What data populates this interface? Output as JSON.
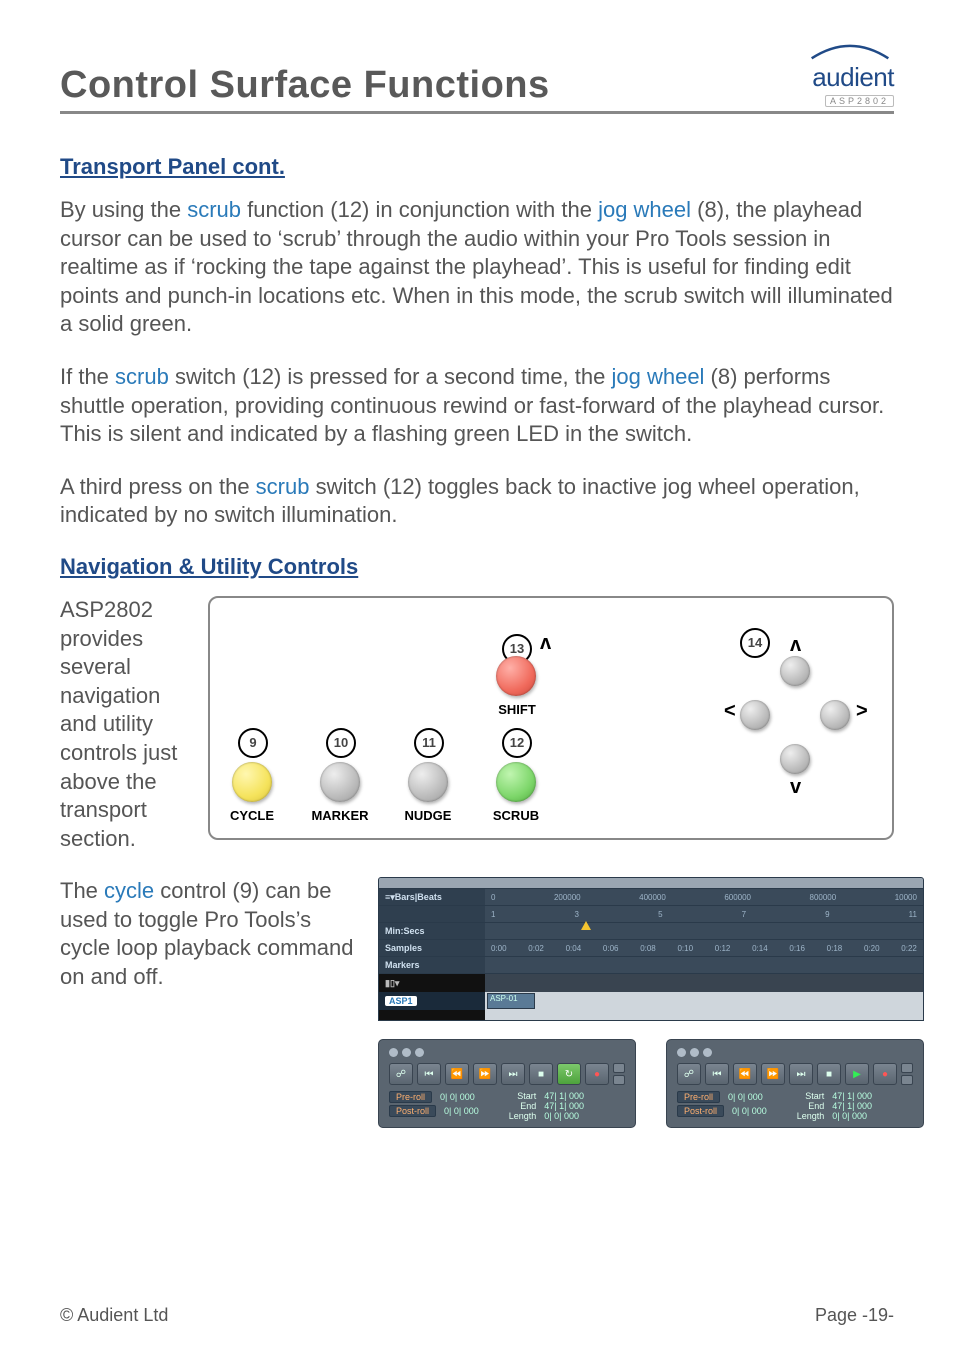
{
  "header": {
    "title": "Control Surface Functions",
    "brand_name": "audient",
    "brand_model": "ASP2802"
  },
  "sections": {
    "s1_heading": "Transport Panel cont.",
    "s2_heading": "Navigation & Utility Controls"
  },
  "para1": {
    "t1": "By using the ",
    "hl1": "scrub",
    "t2": " function (12) in conjunction with the ",
    "hl2": "jog wheel",
    "t3": " (8), the playhead cursor can be used to ‘scrub’ through the audio within your Pro Tools session in realtime as if ‘rocking the tape against the playhead’. This is useful for finding edit points and punch-in locations etc. When in this mode, the scrub switch will illuminated a solid green."
  },
  "para2": {
    "t1": "If the ",
    "hl1": "scrub",
    "t2": " switch (12) is pressed for a second time, the ",
    "hl2": "jog wheel",
    "t3": " (8) performs shuttle operation, providing continuous rewind or fast-forward of the playhead cursor. This is silent and indicated by a flashing green LED in the switch."
  },
  "para3": {
    "t1": "A third press on the ",
    "hl1": "scrub",
    "t2": " switch (12) toggles back to inactive jog wheel operation, indicated by no switch illumination."
  },
  "para_nav_side": "ASP2802 provides several navigation and utility controls just above the transport section.",
  "para_cycle": {
    "t1": "The ",
    "hl1": "cycle",
    "t2": " control (9) can be used to toggle Pro Tools’s cycle loop playback command on and off."
  },
  "diagram": {
    "refs": {
      "r9": "9",
      "r10": "10",
      "r11": "11",
      "r12": "12",
      "r13": "13",
      "r14": "14"
    },
    "labels": {
      "cycle": "CYCLE",
      "marker": "MARKER",
      "nudge": "NUDGE",
      "scrub": "SCRUB",
      "shift": "SHIFT"
    },
    "carets": {
      "up": "ʌ",
      "down": "v",
      "left": "<",
      "right": ">"
    }
  },
  "protools": {
    "ruler_rows": {
      "bars": "Bars|Beats",
      "minsecs": "Min:Secs",
      "samples": "Samples",
      "markers": "Markers"
    },
    "bar_ticks": [
      "0",
      "200000",
      "400000",
      "600000",
      "800000",
      "10000"
    ],
    "bar_nums": [
      "1",
      "3",
      "5",
      "7",
      "9",
      "11"
    ],
    "time_ticks": [
      "0:00",
      "0:02",
      "0:04",
      "0:06",
      "0:08",
      "0:10",
      "0:12",
      "0:14",
      "0:16",
      "0:18",
      "0:20",
      "0:22"
    ],
    "track_name": "ASP1",
    "clip_name": "ASP-01",
    "transport_icons": {
      "online": "☍",
      "rtz": "⏮",
      "rew": "⏪",
      "ffw": "⏩",
      "end": "⏭",
      "stop": "■",
      "play": "▶",
      "rec": "●",
      "loop": "↻"
    },
    "roll": {
      "pre_label": "Pre-roll",
      "post_label": "Post-roll",
      "pre_val": "0| 0| 000",
      "post_val": "0| 0| 000",
      "start_label": "Start",
      "end_label": "End",
      "length_label": "Length",
      "start_val": "47| 1| 000",
      "end_val": "47| 1| 000",
      "length_val": "0| 0| 000"
    }
  },
  "footer": {
    "copyright": "© Audient Ltd",
    "page": "Page -19-"
  }
}
